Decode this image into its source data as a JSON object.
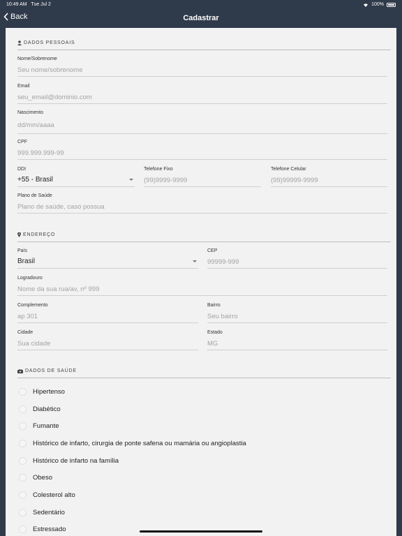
{
  "status": {
    "time": "10:49 AM",
    "date": "Tue Jul 2",
    "battery": "100%"
  },
  "nav": {
    "back_label": "Back",
    "title": "Cadastrar"
  },
  "colors": {
    "header_bg": "#2f3a4a",
    "sheet_bg": "#f2f2f2"
  },
  "personal": {
    "title": "DADOS PESSOAIS",
    "name": {
      "label": "Nome/Sobrenome",
      "placeholder": "Seu nome/sobrenome"
    },
    "email": {
      "label": "Email",
      "placeholder": "seu_email@dominio.com"
    },
    "birth": {
      "label": "Nascimento",
      "placeholder": "dd/mm/aaaa"
    },
    "cpf": {
      "label": "CPF",
      "placeholder": "999.999.999-99"
    },
    "ddi": {
      "label": "DDI",
      "value": "+55 - Brasil"
    },
    "phone": {
      "label": "Telefone Fixo",
      "placeholder": "(99)9999-9999"
    },
    "mobile": {
      "label": "Telefone Celular",
      "placeholder": "(99)99999-9999"
    },
    "plan": {
      "label": "Plano de Saúde",
      "placeholder": "Plano de saúde, caso possua"
    }
  },
  "address": {
    "title": "ENDEREÇO",
    "country": {
      "label": "País",
      "value": "Brasil"
    },
    "cep": {
      "label": "CEP",
      "placeholder": "99999-999"
    },
    "street": {
      "label": "Logradouro",
      "placeholder": "Nome da sua rua/av, nº 999"
    },
    "complement": {
      "label": "Complemento",
      "placeholder": "ap 301"
    },
    "district": {
      "label": "Bairro",
      "placeholder": "Seu bairro"
    },
    "city": {
      "label": "Cidade",
      "placeholder": "Sua cidade"
    },
    "state": {
      "label": "Estado",
      "placeholder": "MG"
    }
  },
  "health": {
    "title": "DADOS DE SAÚDE",
    "items": [
      "Hipertenso",
      "Diabético",
      "Fumante",
      "Histórico de infarto, cirurgia de ponte safena ou mamária ou angioplastia",
      "Histórico de infarto na família",
      "Obeso",
      "Colesterol alto",
      "Sedentário",
      "Estressado"
    ]
  }
}
